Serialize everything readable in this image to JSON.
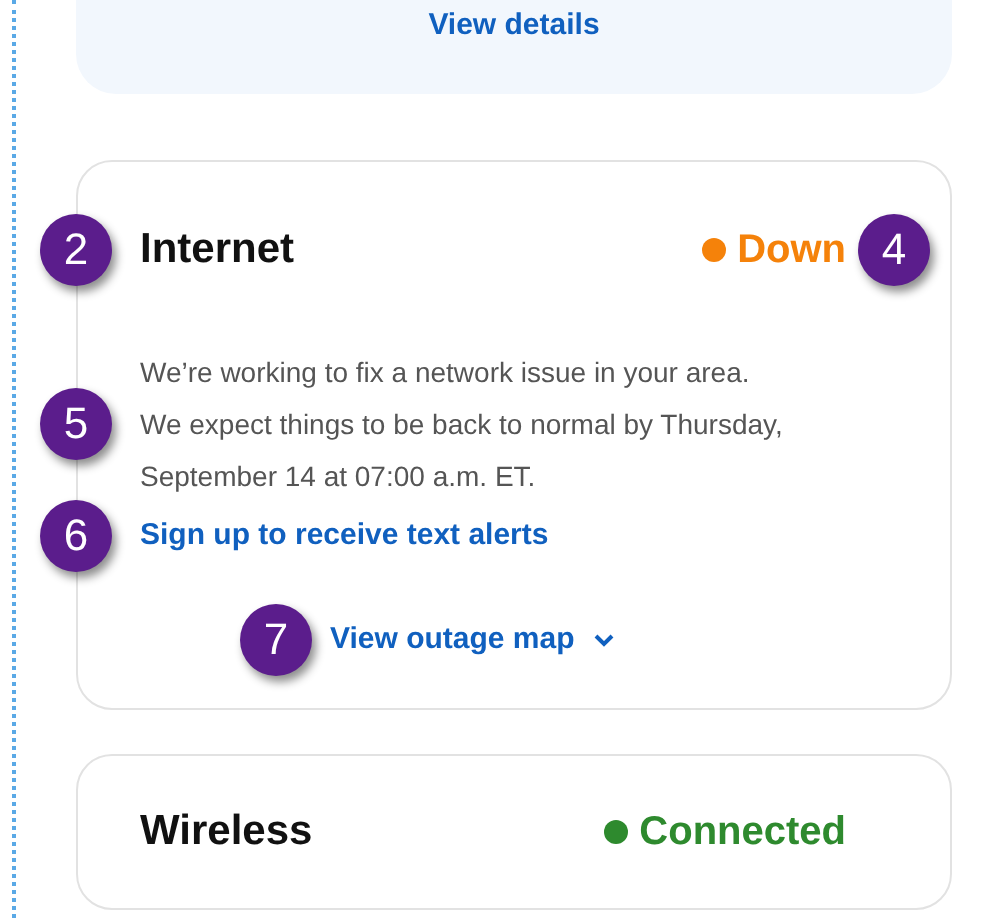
{
  "top_card": {
    "link": "View details"
  },
  "services": [
    {
      "name": {
        "text": "Internet",
        "callout": "2"
      },
      "status": {
        "text": "Down",
        "color": "#f5820a",
        "callout": "4"
      },
      "message": {
        "text": "We’re working to fix a network issue in your area. We expect things to be back to normal by Thursday, September 14 at 07:00 a.m. ET.",
        "callout": "5"
      },
      "alert_link": {
        "text": "Sign up to receive text alerts",
        "callout": "6"
      },
      "map_link": {
        "text": "View outage map",
        "expanded": false,
        "callout": "7"
      }
    },
    {
      "name": {
        "text": "Wireless"
      },
      "status": {
        "text": "Connected",
        "color": "#2e8a2e"
      }
    }
  ]
}
